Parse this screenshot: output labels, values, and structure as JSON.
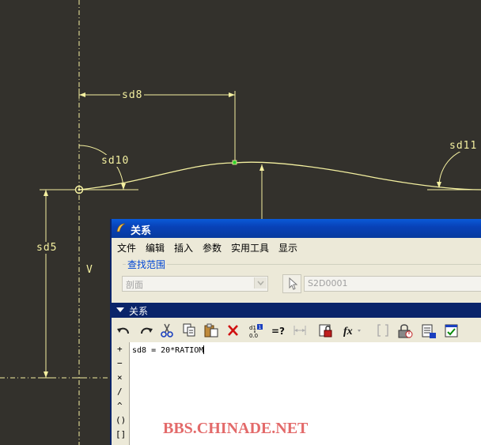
{
  "sketch": {
    "dimensions": {
      "horizontal": "sd8",
      "vertical": "sd5",
      "angle_left": "sd10",
      "angle_right": "sd11",
      "v_label": "V"
    }
  },
  "dialog": {
    "title": "关系",
    "menu": [
      "文件",
      "编辑",
      "插入",
      "参数",
      "实用工具",
      "显示"
    ],
    "find_scope": {
      "legend": "查找范围",
      "scope_value": "剖面",
      "model_value": "S2D0001"
    },
    "relations": {
      "header": "关系",
      "toolbar_icons": [
        "undo-icon",
        "redo-icon",
        "cut-icon",
        "copy-icon",
        "paste-icon",
        "delete-icon",
        "switch-dimensions-icon",
        "evaluate-icon",
        "insert-dimension-icon",
        "lock-icon",
        "function-icon",
        "bracket-icon",
        "sort-icon",
        "export-icon",
        "verify-icon"
      ],
      "operators": [
        "+",
        "−",
        "×",
        "/",
        "^",
        "()",
        "[]"
      ],
      "text": "sd8 = 20*RATIOM"
    }
  },
  "watermark": "BBS.CHINADE.NET"
}
